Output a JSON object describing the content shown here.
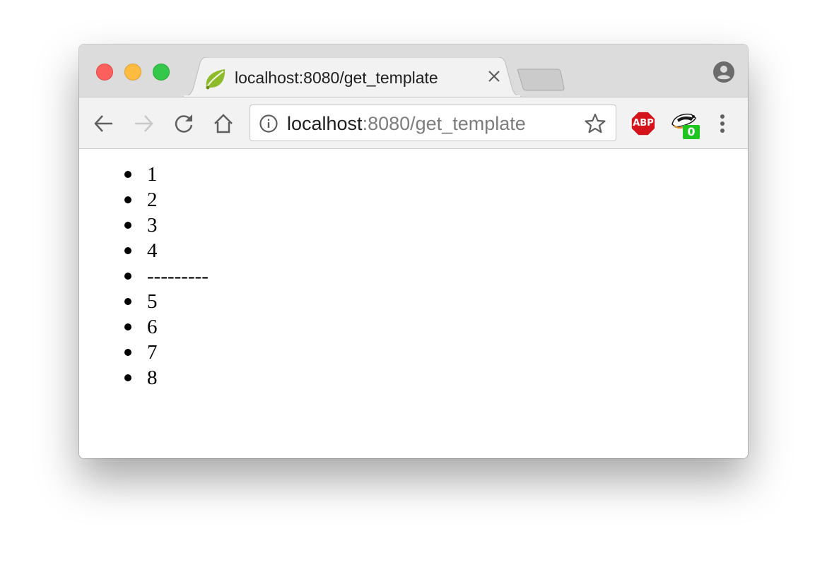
{
  "browser": {
    "tab": {
      "title": "localhost:8080/get_template",
      "favicon": "spring-leaf-icon"
    },
    "address_bar": {
      "host": "localhost",
      "path": ":8080/get_template"
    },
    "extensions": {
      "adblock_label": "ABP",
      "privacy_badger_count": "0"
    },
    "colors": {
      "titlebar": "#dcdcdc",
      "toolbar": "#f2f2f2",
      "close": "#fc605c",
      "minimize": "#fdbc40",
      "maximize": "#34c84a",
      "abp_red": "#d5131a",
      "badger_green": "#1ec51e"
    }
  },
  "page": {
    "list_items": [
      "1",
      "2",
      "3",
      "4",
      "---------",
      "5",
      "6",
      "7",
      "8"
    ]
  }
}
